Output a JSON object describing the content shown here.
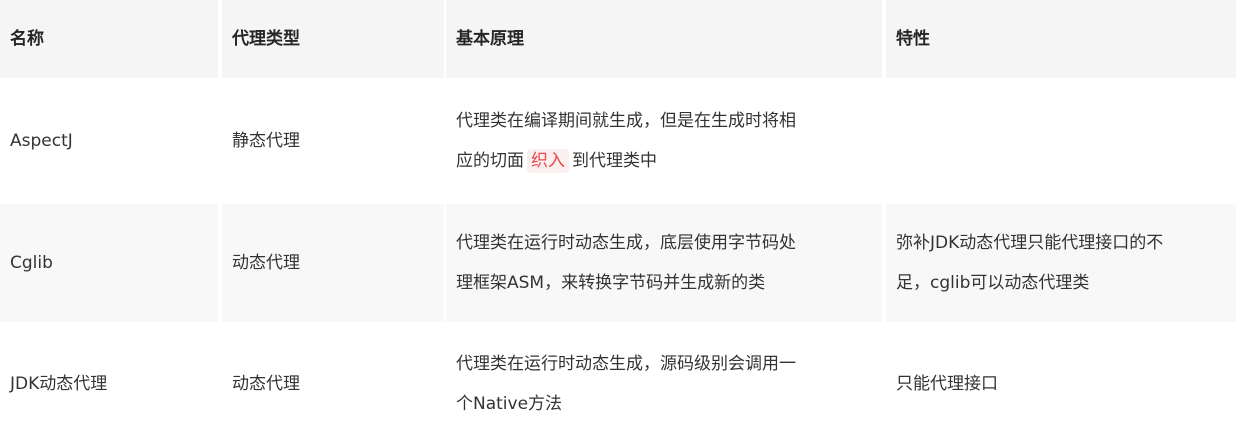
{
  "headers": [
    "名称",
    "代理类型",
    "基本原理",
    "特性"
  ],
  "rows": [
    {
      "name": "AspectJ",
      "type": "静态代理",
      "principle_before": "代理类在编译期间就生成，但是在生成时将相\n应的切面",
      "principle_highlight": "织入",
      "principle_after": "到代理类中",
      "feature": ""
    },
    {
      "name": "Cglib",
      "type": "动态代理",
      "principle": "代理类在运行时动态生成，底层使用字节码处\n理框架ASM，来转换字节码并生成新的类",
      "feature": "弥补JDK动态代理只能代理接口的不\n足，cglib可以动态代理类"
    },
    {
      "name": "JDK动态代理",
      "type": "动态代理",
      "principle": "代理类在运行时动态生成，源码级别会调用一\n个Native方法",
      "feature": "只能代理接口"
    }
  ]
}
